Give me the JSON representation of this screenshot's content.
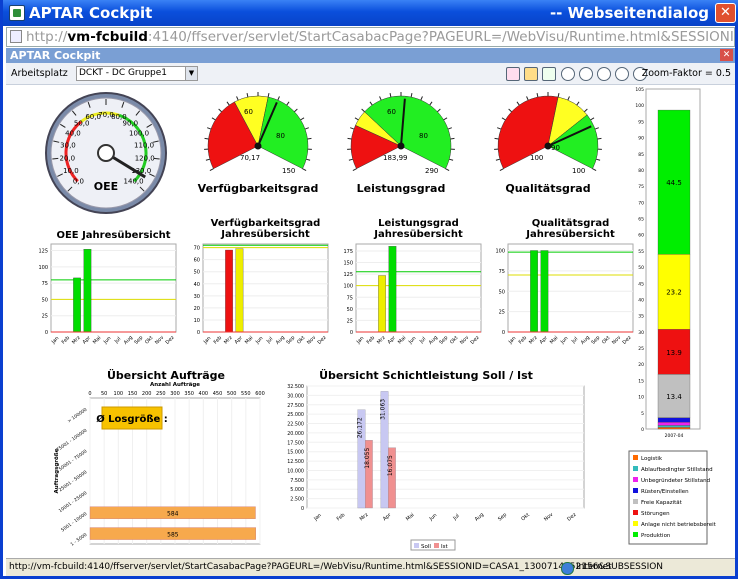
{
  "window": {
    "title": "APTAR Cockpit",
    "dialog": "-- Webseitendialog",
    "url_pre": "http://",
    "url_host": "vm-fcbuild",
    "url_rest": ":4140/ffserver/servlet/StartCasabacPage?PAGEURL=/WebVisu/Runtime.html&SESSIONID=CASA1_1300714152156&"
  },
  "app": {
    "header": "APTAR Cockpit",
    "arbeitsplatz_label": "Arbeitsplatz",
    "arbeitsplatz_value": "DCKT - DC Gruppe1",
    "zoom_label": "Zoom-Faktor = 0.5"
  },
  "status": {
    "url": "http://vm-fcbuild:4140/ffserver/servlet/StartCasabacPage?PAGEURL=/WebVisu/Runtime.html&SESSIONID=CASA1_1300714152156&SUBSESSION",
    "zone": "Internet"
  },
  "oee": {
    "label": "OEE",
    "ticks": [
      "0,0",
      "10,0",
      "20,0",
      "30,0",
      "40,0",
      "50,0",
      "60,0",
      "70,0",
      "80,0",
      "90,0",
      "100,0",
      "110,0",
      "120,0",
      "130,0",
      "140,0"
    ],
    "value": 133
  },
  "gauges": [
    {
      "label": "Verfügbarkeitsgrad",
      "value": "70,17",
      "tick_a": "60",
      "tick_b": "80",
      "tick_c": "150",
      "needle": 0.57
    },
    {
      "label": "Leistungsgrad",
      "value": "183,99",
      "tick_a": "60",
      "tick_b": "80",
      "tick_c": "290",
      "needle": 0.5
    },
    {
      "label": "Qualitätsgrad",
      "value": "100",
      "tick_a": "90",
      "tick_b": "",
      "tick_c": "100",
      "needle": 0.27
    }
  ],
  "months": [
    "Jan",
    "Feb",
    "Mrz",
    "Apr",
    "Mai",
    "Jun",
    "Jul",
    "Aug",
    "Sep",
    "Okt",
    "Nov",
    "Dez"
  ],
  "chart_data": [
    {
      "type": "bar",
      "title": "OEE Jahresübersicht",
      "categories": [
        "Jan",
        "Feb",
        "Mrz",
        "Apr",
        "Mai",
        "Jun",
        "Jul",
        "Aug",
        "Sep",
        "Okt",
        "Nov",
        "Dez"
      ],
      "values": [
        0,
        0,
        83,
        127,
        0,
        0,
        0,
        0,
        0,
        0,
        0,
        0
      ],
      "colors": [
        "#00dd00",
        "#00dd00",
        "#00dd00",
        "#00dd00"
      ],
      "yticks": [
        "0",
        "25",
        "50",
        "75",
        "100",
        "125"
      ],
      "ylim": [
        0,
        135
      ],
      "lines": [
        {
          "y": 50,
          "color": "#dddd00"
        },
        {
          "y": 80,
          "color": "#00cc00"
        }
      ]
    },
    {
      "type": "bar",
      "title": "Verfügbarkeitsgrad Jahresübersicht",
      "categories": [
        "Jan",
        "Feb",
        "Mrz",
        "Apr",
        "Mai",
        "Jun",
        "Jul",
        "Aug",
        "Sep",
        "Okt",
        "Nov",
        "Dez"
      ],
      "values": [
        0,
        0,
        68,
        69,
        0,
        0,
        0,
        0,
        0,
        0,
        0,
        0
      ],
      "colors": [
        "#ee1111",
        "#ee1111",
        "#ee1111",
        "#eeee00"
      ],
      "yticks": [
        "0",
        "10",
        "20",
        "30",
        "40",
        "50",
        "60",
        "70"
      ],
      "ylim": [
        0,
        73
      ],
      "lines": [
        {
          "y": 70,
          "color": "#dddd00"
        },
        {
          "y": 72,
          "color": "#00cc00"
        }
      ]
    },
    {
      "type": "bar",
      "title": "Leistungsgrad Jahresübersicht",
      "categories": [
        "Jan",
        "Feb",
        "Mrz",
        "Apr",
        "Mai",
        "Jun",
        "Jul",
        "Aug",
        "Sep",
        "Okt",
        "Nov",
        "Dez"
      ],
      "values": [
        0,
        0,
        122,
        185,
        0,
        0,
        0,
        0,
        0,
        0,
        0,
        0
      ],
      "colors": [
        "#eeee00",
        "#eeee00",
        "#eeee00",
        "#00dd00"
      ],
      "yticks": [
        "0",
        "25",
        "50",
        "75",
        "100",
        "125",
        "150",
        "175"
      ],
      "ylim": [
        0,
        190
      ],
      "lines": [
        {
          "y": 100,
          "color": "#dddd00"
        },
        {
          "y": 130,
          "color": "#00cc00"
        }
      ]
    },
    {
      "type": "bar",
      "title": "Qualitätsgrad Jahresübersicht",
      "categories": [
        "Jan",
        "Feb",
        "Mrz",
        "Apr",
        "Mai",
        "Jun",
        "Jul",
        "Aug",
        "Sep",
        "Okt",
        "Nov",
        "Dez"
      ],
      "values": [
        0,
        0,
        100,
        100,
        0,
        0,
        0,
        0,
        0,
        0,
        0,
        0
      ],
      "colors": [
        "#00dd00",
        "#00dd00",
        "#00dd00",
        "#00dd00"
      ],
      "yticks": [
        "0",
        "25",
        "50",
        "75",
        "100"
      ],
      "ylim": [
        0,
        108
      ],
      "lines": [
        {
          "y": 70,
          "color": "#dddd00"
        },
        {
          "y": 98,
          "color": "#00cc00"
        }
      ]
    },
    {
      "type": "bar",
      "orientation": "horizontal",
      "title": "Übersicht Aufträge",
      "xlabel": "Anzahl Aufträge",
      "ylabel": "Auftragsgröße",
      "xticks": [
        "0",
        "50",
        "100",
        "150",
        "200",
        "250",
        "300",
        "350",
        "400",
        "450",
        "500",
        "550",
        "600"
      ],
      "xlim": [
        0,
        600
      ],
      "categories": [
        "1 - 5000",
        "5001 - 10000",
        "10001 - 25000",
        "25001 - 50000",
        "50001 - 75000",
        "75001 - 100000",
        "> 100000"
      ],
      "values": [
        585,
        584,
        0,
        0,
        0,
        0,
        0
      ],
      "color": "#f7a94d",
      "annotation": "Ø Losgröße :"
    },
    {
      "type": "bar",
      "title": "Übersicht Schichtleistung Soll / Ist",
      "categories": [
        "Jan",
        "Feb",
        "Mrz",
        "Apr",
        "Mai",
        "Jun",
        "Jul",
        "Aug",
        "Sep",
        "Okt",
        "Nov",
        "Dez"
      ],
      "yticks": [
        "0",
        "2.500",
        "5.000",
        "7.500",
        "10.000",
        "12.500",
        "15.000",
        "17.500",
        "20.000",
        "22.500",
        "25.000",
        "27.500",
        "30.000",
        "32.500"
      ],
      "ylim": [
        0,
        32500
      ],
      "series": [
        {
          "name": "Soll",
          "color": "#c8c8f2",
          "values": [
            0,
            0,
            26172,
            31063,
            0,
            0,
            0,
            0,
            0,
            0,
            0,
            0
          ],
          "labels": [
            "",
            "",
            "26.172",
            "31.063",
            "",
            "",
            "",
            "",
            "",
            "",
            "",
            ""
          ]
        },
        {
          "name": "Ist",
          "color": "#f09090",
          "values": [
            0,
            0,
            18055,
            16075,
            0,
            0,
            0,
            0,
            0,
            0,
            0,
            0
          ],
          "labels": [
            "",
            "",
            "18.055",
            "16.075",
            "",
            "",
            "",
            "",
            "",
            "",
            "",
            ""
          ]
        }
      ]
    },
    {
      "type": "bar",
      "orientation": "stacked",
      "title": "",
      "categories": [
        "2007-04"
      ],
      "yticks": [
        "0",
        "5",
        "10",
        "15",
        "20",
        "25",
        "30",
        "35",
        "40",
        "45",
        "50",
        "55",
        "60",
        "65",
        "70",
        "75",
        "80",
        "85",
        "90",
        "95",
        "100",
        "105"
      ],
      "ylim": [
        0,
        105
      ],
      "series": [
        {
          "name": "Logistik",
          "color": "#ff6a00",
          "value": 0.5,
          "label": ""
        },
        {
          "name": "Ablaufbedingter Stillstand",
          "color": "#33bbbb",
          "value": 0.6,
          "label": ""
        },
        {
          "name": "Unbegründeter Stillstand",
          "color": "#ee22ee",
          "value": 1.0,
          "label": ""
        },
        {
          "name": "Rüsten/Einstellen",
          "color": "#1111dd",
          "value": 1.4,
          "label": ""
        },
        {
          "name": "Freie Kapazität",
          "color": "#c0c0c0",
          "value": 13.4,
          "label": "13.4"
        },
        {
          "name": "Störungen",
          "color": "#ee1111",
          "value": 13.9,
          "label": "13.9"
        },
        {
          "name": "Anlage nicht betriebsbereit",
          "color": "#ffff00",
          "value": 23.2,
          "label": "23.2"
        },
        {
          "name": "Produktion",
          "color": "#00ee00",
          "value": 44.5,
          "label": "44.5"
        }
      ]
    }
  ]
}
